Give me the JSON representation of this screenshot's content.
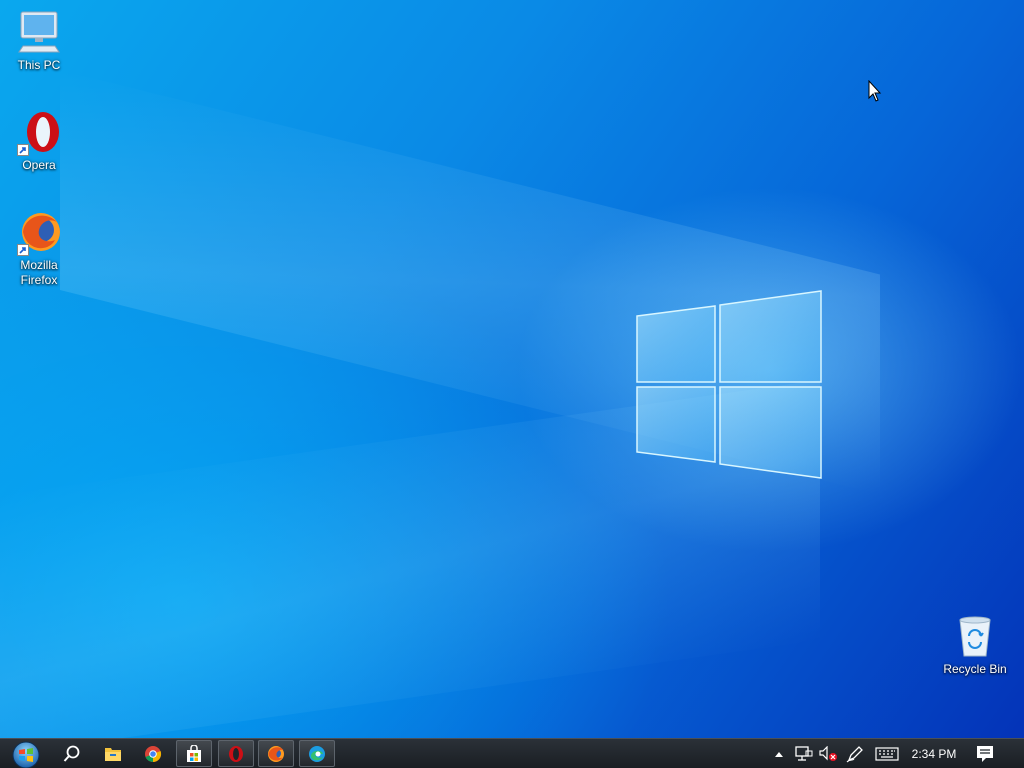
{
  "desktop": {
    "icons": [
      {
        "label": "This PC",
        "icon": "computer-icon"
      },
      {
        "label": "Opera",
        "icon": "opera-icon"
      },
      {
        "label": "Mozilla Firefox",
        "icon": "firefox-icon"
      },
      {
        "label": "Recycle Bin",
        "icon": "recycle-bin-icon"
      }
    ]
  },
  "taskbar": {
    "start_icon": "windows-orb-icon",
    "pinned": [
      {
        "name": "Search",
        "icon": "search-icon"
      },
      {
        "name": "File Explorer",
        "icon": "folder-icon"
      },
      {
        "name": "Google Chrome",
        "icon": "chrome-icon"
      },
      {
        "name": "Microsoft Store",
        "icon": "store-icon"
      },
      {
        "name": "Opera",
        "icon": "opera-icon"
      },
      {
        "name": "Firefox",
        "icon": "firefox-icon"
      },
      {
        "name": "Microsoft Edge",
        "icon": "edge-icon"
      }
    ],
    "tray": {
      "icons": [
        "chevron-up-icon",
        "network-icon",
        "volume-muted-icon",
        "pen-icon",
        "keyboard-icon",
        "notification-icon"
      ],
      "clock": "2:34 PM"
    }
  },
  "colors": {
    "wallpaper_blue": "#0a7fe0",
    "taskbar_bg": "#1f2429"
  }
}
